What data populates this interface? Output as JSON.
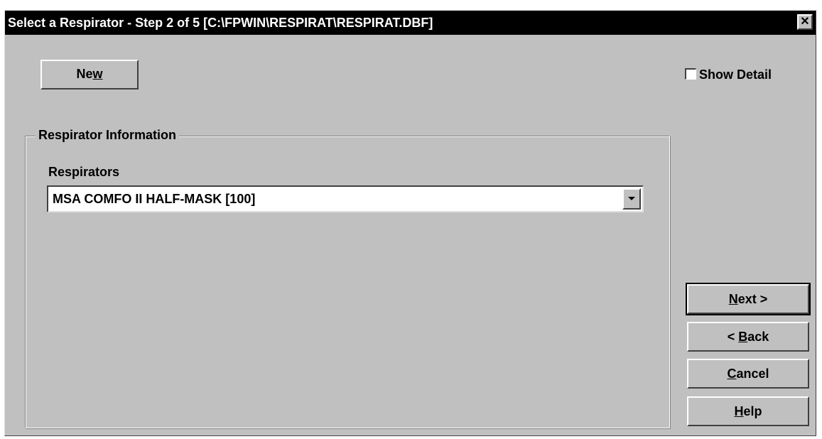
{
  "window": {
    "title": "Select a Respirator - Step 2 of 5 [C:\\FPWIN\\RESPIRAT\\RESPIRAT.DBF]",
    "close_icon": "close-icon"
  },
  "toolbar": {
    "new_label_pre": "Ne",
    "new_label_accel": "w",
    "new_label_post": ""
  },
  "options": {
    "show_detail_label": "Show Detail",
    "show_detail_checked": false
  },
  "group": {
    "legend": "Respirator Information",
    "respirators_label": "Respirators",
    "respirators_selected": "MSA COMFO II HALF-MASK [100]",
    "dropdown_icon": "chevron-down-icon"
  },
  "nav": {
    "next": {
      "accel": "N",
      "rest": "ext >"
    },
    "back": {
      "pre": "< ",
      "accel": "B",
      "rest": "ack"
    },
    "cancel": {
      "accel": "C",
      "rest": "ancel"
    },
    "help": {
      "accel": "H",
      "rest": "elp"
    }
  },
  "colors": {
    "face": "#c0c0c0",
    "titlebar": "#000000",
    "title_text": "#ffffff"
  }
}
